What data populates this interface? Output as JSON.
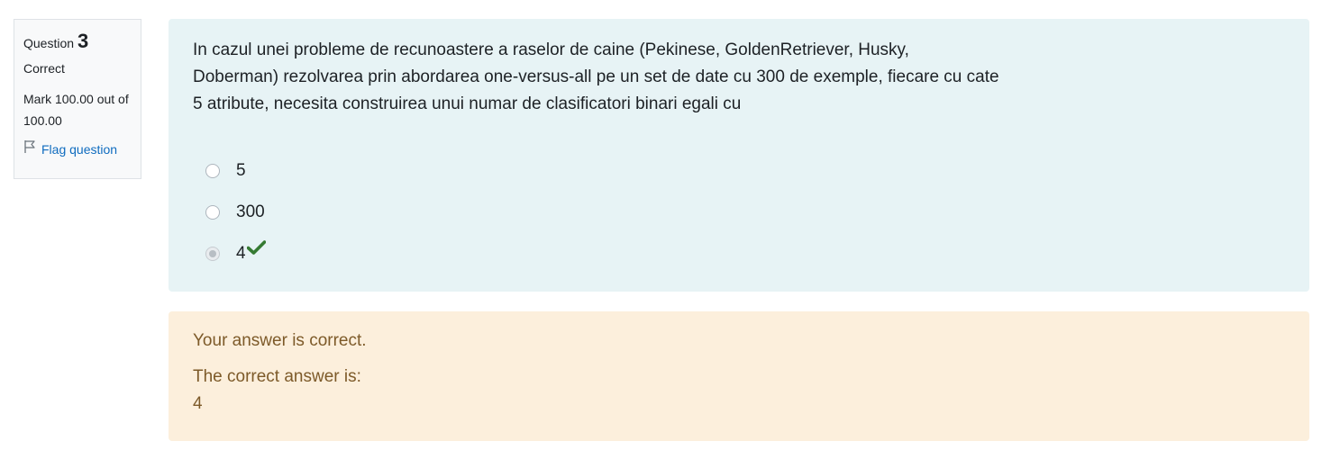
{
  "info": {
    "question_label": "Question",
    "question_number": "3",
    "state": "Correct",
    "grade": "Mark 100.00 out of 100.00",
    "flag_label": "Flag question"
  },
  "question": {
    "line1": "In cazul unei probleme de recunoastere a raselor de caine (Pekinese, GoldenRetriever, Husky,",
    "line2": "Doberman) rezolvarea prin abordarea one-versus-all pe un set de date cu 300 de exemple, fiecare cu cate",
    "line3": "5 atribute, necesita construirea unui numar de clasificatori binari egali cu",
    "options": [
      {
        "label": "5",
        "selected": false
      },
      {
        "label": "300",
        "selected": false
      },
      {
        "label": "4",
        "selected": true,
        "correct": true
      }
    ]
  },
  "outcome": {
    "feedback": "Your answer is correct.",
    "right_answer_label": "The correct answer is:",
    "right_answer_value": "4"
  },
  "colors": {
    "formulation_bg": "#e7f3f5",
    "outcome_bg": "#fcefdc",
    "check": "#357a32",
    "link": "#0f6cbf"
  }
}
